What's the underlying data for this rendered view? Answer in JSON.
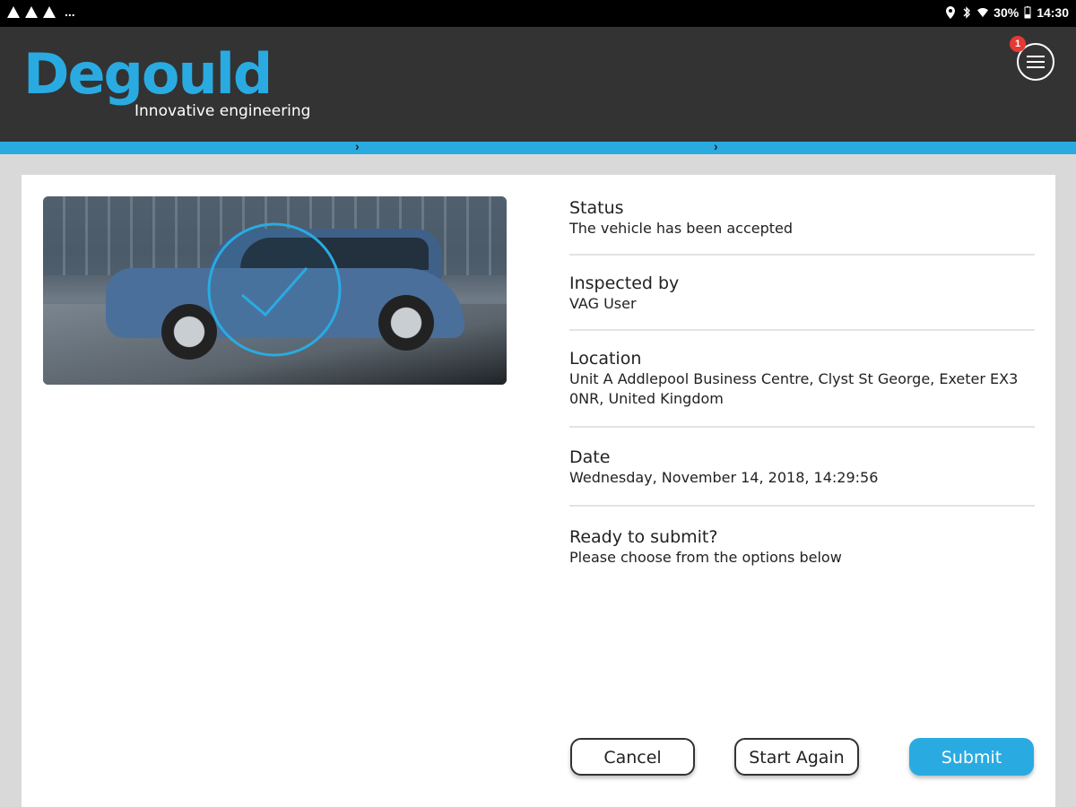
{
  "statusbar": {
    "dots": "...",
    "battery": "30%",
    "time": "14:30"
  },
  "header": {
    "logo": "Degould",
    "tagline": "Innovative engineering",
    "notification_count": "1"
  },
  "colors": {
    "brand_blue": "#29abe2",
    "header_bg": "#333333",
    "badge_red": "#e53935"
  },
  "details": {
    "status_label": "Status",
    "status_value": "The vehicle has been accepted",
    "inspected_label": "Inspected by",
    "inspected_value": "VAG User",
    "location_label": "Location",
    "location_line1": "Unit A Addlepool Business Centre, Clyst St George, Exeter EX3",
    "location_line2": "0NR, United Kingdom",
    "date_label": "Date",
    "date_value": "Wednesday, November 14, 2018, 14:29:56",
    "ready_label": "Ready to submit?",
    "ready_value": "Please choose from the options below"
  },
  "buttons": {
    "cancel": "Cancel",
    "start_again": "Start Again",
    "submit": "Submit"
  },
  "icons": [
    "warning-icon",
    "location-icon",
    "bluetooth-icon",
    "wifi-icon",
    "battery-icon",
    "menu-icon",
    "chevron-right-icon",
    "checkmark-icon"
  ]
}
